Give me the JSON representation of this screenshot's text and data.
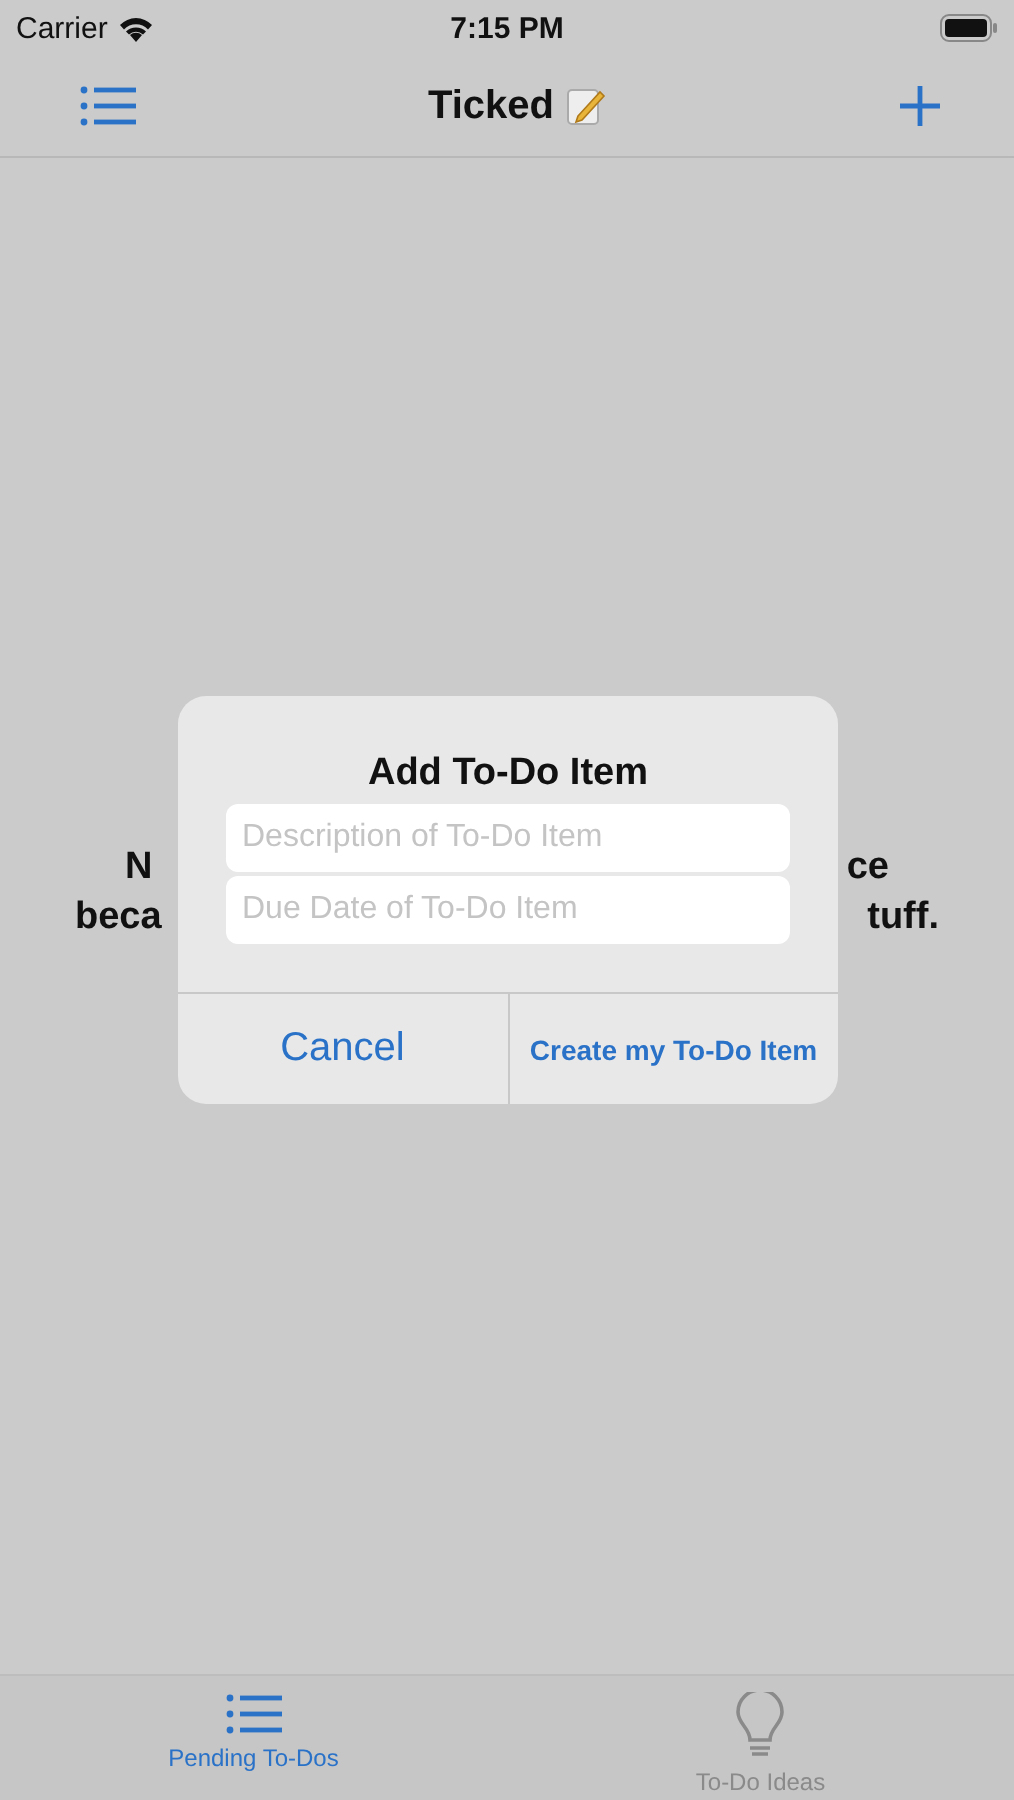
{
  "status_bar": {
    "carrier": "Carrier",
    "time": "7:15 PM"
  },
  "nav_bar": {
    "title": "Ticked"
  },
  "background_message": {
    "lines": [
      {
        "left": "N",
        "right": "ce"
      },
      {
        "left": "beca",
        "right": "tuff."
      }
    ]
  },
  "dialog": {
    "title": "Add To-Do Item",
    "fields": [
      {
        "placeholder": "Description of To-Do Item"
      },
      {
        "placeholder": "Due Date of To-Do Item"
      }
    ],
    "buttons": [
      {
        "label": "Cancel",
        "kind": "cancel"
      },
      {
        "label": "Create my To-Do Item",
        "kind": "confirm"
      }
    ]
  },
  "tab_bar": {
    "tabs": [
      {
        "label": "Pending To-Dos",
        "kind": "list",
        "selected": true
      },
      {
        "label": "To-Do Ideas",
        "kind": "bulb",
        "selected": false
      }
    ]
  }
}
